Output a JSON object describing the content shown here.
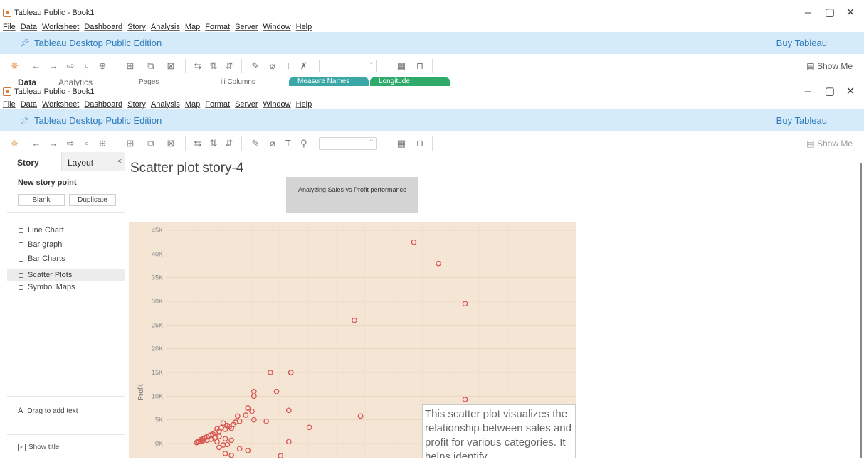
{
  "window": {
    "title": "Tableau Public - Book1",
    "controls": [
      "–",
      "▢",
      "✕"
    ]
  },
  "menu": [
    "File",
    "Data",
    "Worksheet",
    "Dashboard",
    "Story",
    "Analysis",
    "Map",
    "Format",
    "Server",
    "Window",
    "Help"
  ],
  "edition_bar": {
    "label": "Tableau Desktop Public Edition",
    "buy": "Buy Tableau"
  },
  "toolbar": {
    "show_me": "Show Me"
  },
  "background_window": {
    "data_tab": "Data",
    "analytics_tab": "Analytics",
    "pages": "Pages",
    "columns": "iii Columns",
    "pill_measure": "Measure Names",
    "pill_longitude": "Longitude (generate"
  },
  "story_pane": {
    "tab_story": "Story",
    "tab_layout": "Layout",
    "collapse": "<",
    "new_story_point": "New story point",
    "blank": "Blank",
    "duplicate": "Duplicate",
    "sheets": [
      "Line Chart",
      "Bar graph",
      "Bar Charts",
      "Scatter Plots",
      "Symbol Maps"
    ],
    "active_sheet": "Scatter Plots",
    "drag_text": "Drag to add text",
    "show_title": "Show title"
  },
  "story": {
    "title": "Scatter plot story-4",
    "caption": "Analyzing Sales vs Profit performance",
    "annotation": "This scatter plot visualizes the relationship between sales and profit for various categories. It helps identify"
  },
  "colors": {
    "edition_bar": "#d6ebfa",
    "plot_background": "#f4e5d4",
    "point": "#d9534f",
    "pill_measure": "#3aa6a6",
    "pill_longitude": "#2eaa6a"
  },
  "chart_data": {
    "type": "scatter",
    "ylabel": "Profit",
    "yticks": [
      "45K",
      "40K",
      "35K",
      "30K",
      "25K",
      "20K",
      "15K",
      "10K",
      "5K",
      "0K"
    ],
    "ylim": [
      -3000,
      47000
    ],
    "xlim": [
      0,
      100
    ],
    "grid": true,
    "points": [
      [
        60.5,
        42500
      ],
      [
        66.5,
        38000
      ],
      [
        73,
        29500
      ],
      [
        46,
        26000
      ],
      [
        25.5,
        15000
      ],
      [
        30.5,
        15000
      ],
      [
        27,
        11000
      ],
      [
        21.5,
        11000
      ],
      [
        21.5,
        10000
      ],
      [
        73,
        9300
      ],
      [
        30,
        7000
      ],
      [
        20,
        7500
      ],
      [
        21,
        6800
      ],
      [
        47.5,
        5800
      ],
      [
        19.5,
        6000
      ],
      [
        21.5,
        5000
      ],
      [
        24.5,
        4700
      ],
      [
        18,
        4700
      ],
      [
        17.5,
        5800
      ],
      [
        35,
        3400
      ],
      [
        17,
        4500
      ],
      [
        16.5,
        4000
      ],
      [
        14,
        4300
      ],
      [
        15,
        3800
      ],
      [
        16,
        3200
      ],
      [
        15.5,
        3600
      ],
      [
        14.5,
        3000
      ],
      [
        13.5,
        3300
      ],
      [
        12.5,
        3100
      ],
      [
        13,
        2600
      ],
      [
        12,
        2200
      ],
      [
        11.5,
        2000
      ],
      [
        11,
        1800
      ],
      [
        10.5,
        1600
      ],
      [
        10,
        1400
      ],
      [
        9.5,
        1200
      ],
      [
        9,
        1000
      ],
      [
        8.5,
        800
      ],
      [
        13,
        1500
      ],
      [
        12,
        1200
      ],
      [
        11,
        900
      ],
      [
        10,
        700
      ],
      [
        9,
        600
      ],
      [
        8,
        500
      ],
      [
        8.5,
        400
      ],
      [
        7.8,
        300
      ],
      [
        7.5,
        200
      ],
      [
        12.5,
        400
      ],
      [
        14.5,
        1000
      ],
      [
        16,
        700
      ],
      [
        30,
        400
      ],
      [
        14,
        -300
      ],
      [
        15,
        -200
      ],
      [
        13,
        -800
      ],
      [
        18,
        -1100
      ],
      [
        20,
        -1500
      ],
      [
        14.5,
        -2100
      ],
      [
        16,
        -2500
      ],
      [
        28,
        -2600
      ]
    ]
  }
}
